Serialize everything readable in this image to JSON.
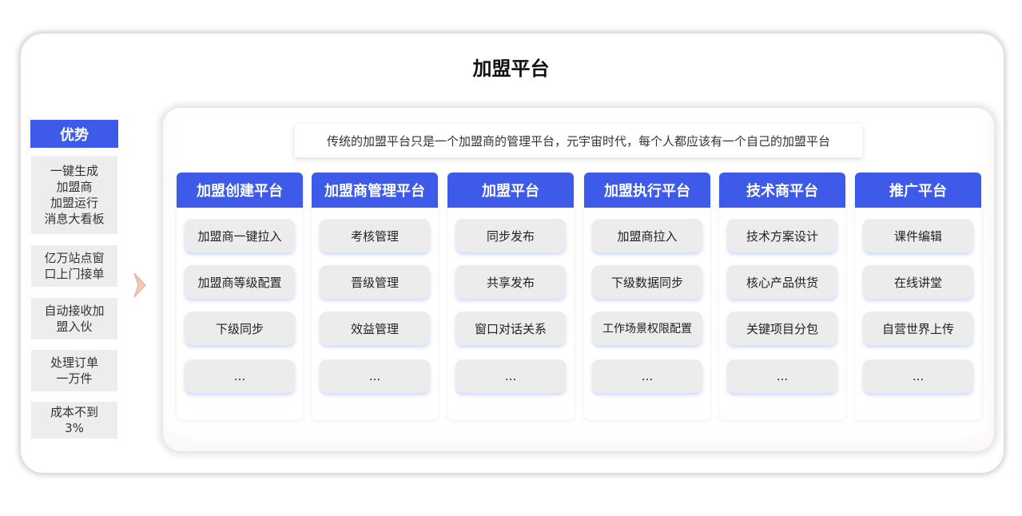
{
  "title": "加盟平台",
  "advantages": {
    "heading": "优势",
    "items": [
      "一键生成\n加盟商\n加盟运行\n消息大看板",
      "亿万站点窗\n口上门接单",
      "自动接收加\n盟入伙",
      "处理订单\n一万件",
      "成本不到\n3%"
    ]
  },
  "description": "传统的加盟平台只是一个加盟商的管理平台，元宇宙时代，每个人都应该有一个自己的加盟平台",
  "columns": [
    {
      "title": "加盟创建平台",
      "items": [
        "加盟商一键拉入",
        "加盟商等级配置",
        "下级同步",
        "..."
      ]
    },
    {
      "title": "加盟商管理平台",
      "items": [
        "考核管理",
        "晋级管理",
        "效益管理",
        "..."
      ]
    },
    {
      "title": "加盟平台",
      "items": [
        "同步发布",
        "共享发布",
        "窗口对话关系",
        "..."
      ]
    },
    {
      "title": "加盟执行平台",
      "items": [
        "加盟商拉入",
        "下级数据同步",
        "工作场景权限配置",
        "..."
      ]
    },
    {
      "title": "技术商平台",
      "items": [
        "技术方案设计",
        "核心产品供货",
        "关键项目分包",
        "..."
      ]
    },
    {
      "title": "推广平台",
      "items": [
        "课件编辑",
        "在线讲堂",
        "自营世界上传",
        "..."
      ]
    }
  ],
  "colors": {
    "accent": "#3d5ae8",
    "cell_bg": "#ececec",
    "advantage_bg": "#ededed"
  }
}
